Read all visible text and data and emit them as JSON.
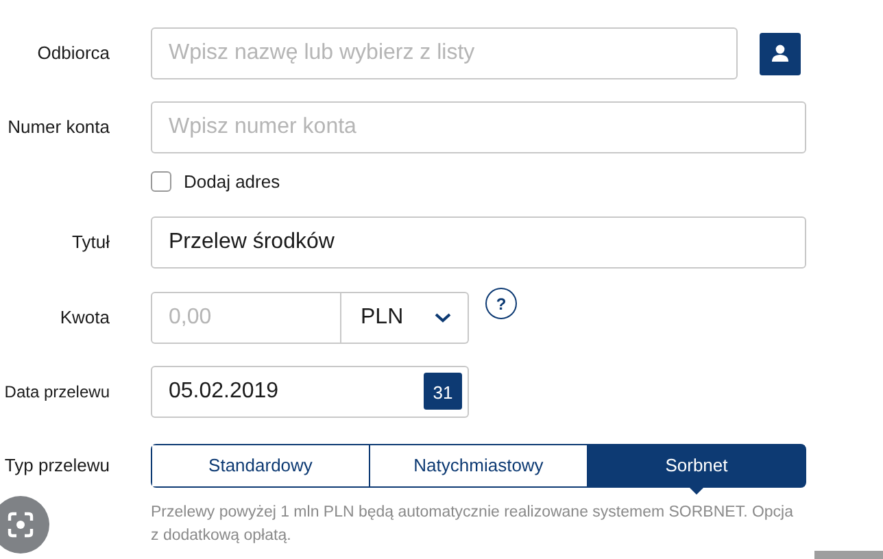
{
  "recipient": {
    "label": "Odbiorca",
    "placeholder": "Wpisz nazwę lub wybierz z listy"
  },
  "account": {
    "label": "Numer konta",
    "placeholder": "Wpisz numer konta"
  },
  "add_address": {
    "label": "Dodaj adres",
    "checked": false
  },
  "title": {
    "label": "Tytuł",
    "value": "Przelew środków"
  },
  "amount": {
    "label": "Kwota",
    "placeholder": "0,00",
    "currency": "PLN",
    "help": "?"
  },
  "date": {
    "label": "Data przelewu",
    "value": "05.02.2019",
    "calendar_day": "31"
  },
  "transfer_type": {
    "label": "Typ przelewu",
    "options": [
      {
        "label": "Standardowy",
        "selected": false
      },
      {
        "label": "Natychmiastowy",
        "selected": false
      },
      {
        "label": "Sorbnet",
        "selected": true
      }
    ]
  },
  "note": "Przelewy powyżej 1 mln PLN będą automatycznie realizowane systemem SORBNET. Opcja z dodatkową opłatą."
}
